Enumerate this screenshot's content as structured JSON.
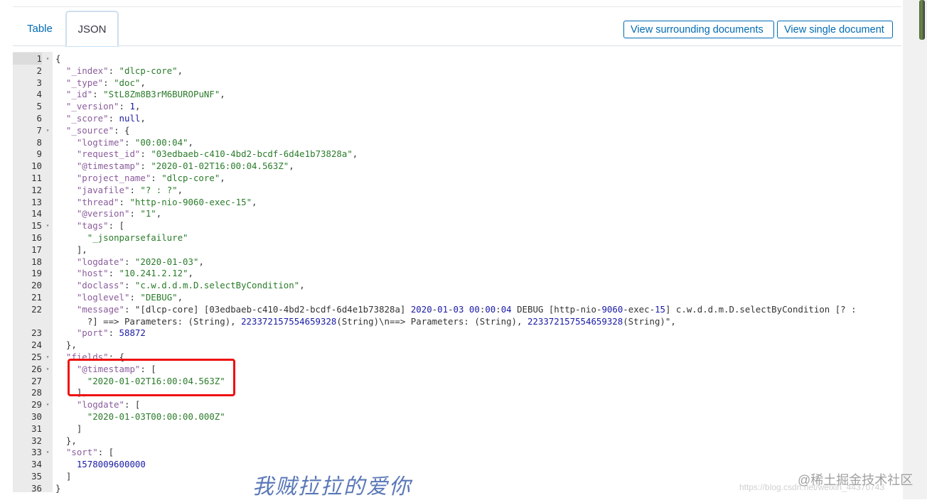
{
  "tabs": [
    {
      "label": "Table",
      "active": false
    },
    {
      "label": "JSON",
      "active": true
    }
  ],
  "actions": {
    "surrounding": "View surrounding documents",
    "single": "View single document"
  },
  "colors": {
    "link_blue": "#006bb4",
    "gutter_bg": "#ebebeb",
    "highlight_box": "#ee1111",
    "watermark_blue": "#5a78b8"
  },
  "json_lines": [
    {
      "n": "1",
      "fold": true,
      "text": "{"
    },
    {
      "n": "2",
      "text": "  \"_index\": \"dlcp-core\","
    },
    {
      "n": "3",
      "text": "  \"_type\": \"doc\","
    },
    {
      "n": "4",
      "text": "  \"_id\": \"StL8Zm8B3rM6BUROPuNF\","
    },
    {
      "n": "5",
      "text": "  \"_version\": 1,"
    },
    {
      "n": "6",
      "text": "  \"_score\": null,"
    },
    {
      "n": "7",
      "fold": true,
      "text": "  \"_source\": {"
    },
    {
      "n": "8",
      "text": "    \"logtime\": \"00:00:04\","
    },
    {
      "n": "9",
      "text": "    \"request_id\": \"03edbaeb-c410-4bd2-bcdf-6d4e1b73828a\","
    },
    {
      "n": "10",
      "text": "    \"@timestamp\": \"2020-01-02T16:00:04.563Z\","
    },
    {
      "n": "11",
      "text": "    \"project_name\": \"dlcp-core\","
    },
    {
      "n": "12",
      "text": "    \"javafile\": \"? : ?\","
    },
    {
      "n": "13",
      "text": "    \"thread\": \"http-nio-9060-exec-15\","
    },
    {
      "n": "14",
      "text": "    \"@version\": \"1\","
    },
    {
      "n": "15",
      "fold": true,
      "text": "    \"tags\": ["
    },
    {
      "n": "16",
      "text": "      \"_jsonparsefailure\""
    },
    {
      "n": "17",
      "text": "    ],"
    },
    {
      "n": "18",
      "text": "    \"logdate\": \"2020-01-03\","
    },
    {
      "n": "19",
      "text": "    \"host\": \"10.241.2.12\","
    },
    {
      "n": "20",
      "text": "    \"doclass\": \"c.w.d.d.m.D.selectByCondition\","
    },
    {
      "n": "21",
      "text": "    \"loglevel\": \"DEBUG\","
    },
    {
      "n": "22",
      "text": "    \"message\": \"[dlcp-core] [03edbaeb-c410-4bd2-bcdf-6d4e1b73828a] 2020-01-03 00:00:04 DEBUG [http-nio-9060-exec-15] c.w.d.d.m.D.selectByCondition [? :"
    },
    {
      "n": "",
      "text": "      ?] ==> Parameters: (String), 223372157554659328(String)\\n==> Parameters: (String), 223372157554659328(String)\","
    },
    {
      "n": "23",
      "text": "    \"port\": 58872"
    },
    {
      "n": "24",
      "text": "  },"
    },
    {
      "n": "25",
      "fold": true,
      "text": "  \"fields\": {"
    },
    {
      "n": "26",
      "fold": true,
      "text": "    \"@timestamp\": ["
    },
    {
      "n": "27",
      "text": "      \"2020-01-02T16:00:04.563Z\""
    },
    {
      "n": "28",
      "text": "    ],"
    },
    {
      "n": "29",
      "fold": true,
      "text": "    \"logdate\": ["
    },
    {
      "n": "30",
      "text": "      \"2020-01-03T00:00:00.000Z\""
    },
    {
      "n": "31",
      "text": "    ]"
    },
    {
      "n": "32",
      "text": "  },"
    },
    {
      "n": "33",
      "fold": true,
      "text": "  \"sort\": ["
    },
    {
      "n": "34",
      "text": "    1578009600000"
    },
    {
      "n": "35",
      "text": "  ]"
    },
    {
      "n": "36",
      "text": "}"
    }
  ],
  "watermarks": {
    "caption": "我贼拉拉的爱你",
    "site": "@稀土掘金技术社区",
    "url": "https://blog.csdn.net/weixin_44370743"
  }
}
